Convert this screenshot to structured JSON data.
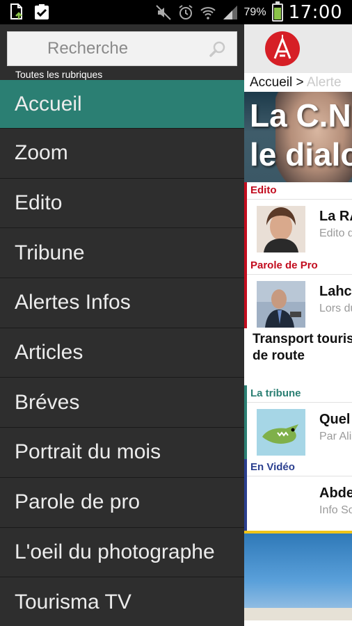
{
  "status_bar": {
    "battery_percent": "79%",
    "time": "17:00",
    "icons": [
      "file-upload-icon",
      "clipboard-check-icon",
      "muted-icon",
      "alarm-icon",
      "wifi-icon",
      "signal-icon",
      "battery-charging-icon"
    ]
  },
  "drawer": {
    "search": {
      "placeholder": "Recherche",
      "value": ""
    },
    "caption": "Toutes les rubriques",
    "menu": [
      {
        "label": "Accueil",
        "active": true
      },
      {
        "label": "Zoom"
      },
      {
        "label": "Edito"
      },
      {
        "label": "Tribune"
      },
      {
        "label": "Alertes Infos"
      },
      {
        "label": "Articles"
      },
      {
        "label": "Bréves"
      },
      {
        "label": "Portrait du mois"
      },
      {
        "label": "Parole de pro"
      },
      {
        "label": "L'oeil du photographe"
      },
      {
        "label": "Tourisma TV"
      }
    ]
  },
  "content": {
    "breadcrumb": {
      "home": "Accueil",
      "sep": ">",
      "current": "Alerte"
    },
    "hero": {
      "line1": "La C.N",
      "line2": "le dialo"
    },
    "sections": {
      "edito": {
        "label": "Edito",
        "title": "La RA",
        "subtitle": "Edito d"
      },
      "parole": {
        "label": "Parole de Pro",
        "title": "Lahce",
        "subtitle": "Lors du",
        "article_line1": "Transport touris",
        "article_line2": "de route"
      },
      "tribune": {
        "label": "La tribune",
        "title": "Quel a",
        "subtitle": "Par Ali"
      },
      "video": {
        "label": "En Vidéo",
        "title": "Abder",
        "subtitle": "Info So"
      }
    }
  },
  "colors": {
    "drawer_bg": "#2e2e2e",
    "active_item": "#2b7f73",
    "edito_red": "#c20c1e",
    "tribune_green": "#2b7f73",
    "video_blue": "#2a3f8f",
    "accent_yellow": "#f0c419"
  }
}
